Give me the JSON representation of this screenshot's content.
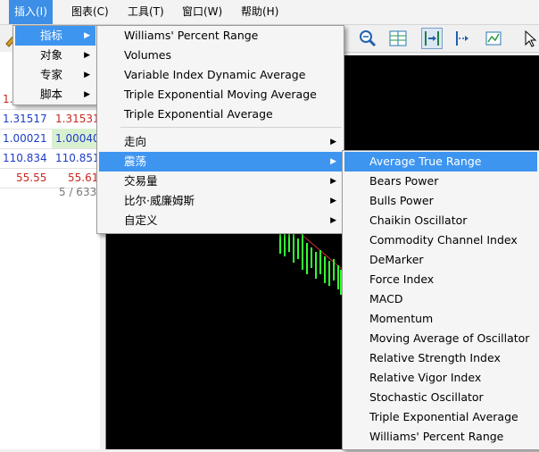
{
  "menubar": {
    "items": [
      {
        "label": "插入(I)",
        "active": true
      },
      {
        "label": "图表(C)"
      },
      {
        "label": "工具(T)"
      },
      {
        "label": "窗口(W)"
      },
      {
        "label": "帮助(H)"
      }
    ]
  },
  "insert_menu": {
    "items": [
      {
        "label": "指标",
        "selected": true
      },
      {
        "label": "对象"
      },
      {
        "label": "专家"
      },
      {
        "label": "脚本"
      }
    ]
  },
  "indicators_menu": {
    "items": [
      {
        "label": "Williams' Percent Range"
      },
      {
        "label": "Volumes"
      },
      {
        "label": "Variable Index Dynamic Average"
      },
      {
        "label": "Triple Exponential Moving Average"
      },
      {
        "label": "Triple Exponential Average"
      }
    ],
    "categories": [
      {
        "label": "走向"
      },
      {
        "label": "震荡",
        "selected": true
      },
      {
        "label": "交易量"
      },
      {
        "label": "比尔·威廉姆斯"
      },
      {
        "label": "自定义"
      }
    ]
  },
  "oscillators_menu": {
    "items": [
      {
        "label": "Average True Range",
        "selected": true
      },
      {
        "label": "Bears Power"
      },
      {
        "label": "Bulls Power"
      },
      {
        "label": "Chaikin Oscillator"
      },
      {
        "label": "Commodity Channel Index"
      },
      {
        "label": "DeMarker"
      },
      {
        "label": "Force Index"
      },
      {
        "label": "MACD"
      },
      {
        "label": "Momentum"
      },
      {
        "label": "Moving Average of Oscillator"
      },
      {
        "label": "Relative Strength Index"
      },
      {
        "label": "Relative Vigor Index"
      },
      {
        "label": "Stochastic Oscillator"
      },
      {
        "label": "Triple Exponential Average"
      },
      {
        "label": "Williams' Percent Range"
      }
    ]
  },
  "market_watch": {
    "rows": [
      {
        "bid": "1.",
        "ask": "",
        "bid_color": "#c8281e"
      },
      {
        "bid": "1.31517",
        "ask": "1.31531",
        "ask_color": "#c8281e"
      },
      {
        "bid": "1.00021",
        "ask": "1.00040"
      },
      {
        "bid": "110.834",
        "ask": "110.851"
      },
      {
        "bid": "55.55",
        "ask": "55.61",
        "bid_color": "#c8281e",
        "ask_color": "#c8281e"
      }
    ],
    "count": "5 / 633"
  },
  "colors": {
    "menu_highlight": "#3d95f0",
    "chart_background": "#000000",
    "candle_color": "#33ff33"
  },
  "icons": {
    "toolbar": [
      "pencil-icon",
      "zoom-in-icon",
      "fit-chart-icon",
      "chart-shift-icon",
      "autoscroll-icon",
      "properties-icon",
      "cursor-icon"
    ]
  }
}
